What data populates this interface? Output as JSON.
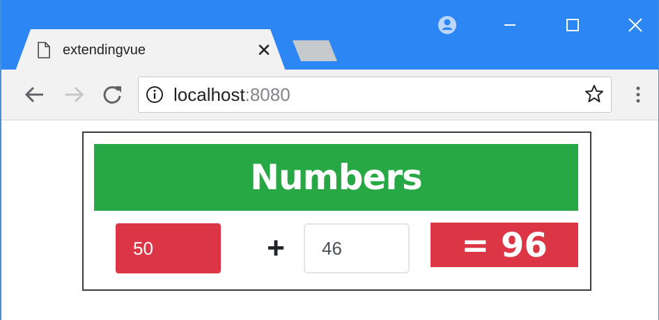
{
  "browser": {
    "tab_title": "extendingvue",
    "tab_close_glyph": "✕",
    "url_host": "localhost",
    "url_port": ":8080",
    "titlebar_color": "#2c86f3",
    "icons": {
      "tab": "page-icon",
      "profile": "account-icon",
      "minimize": "minimize-icon",
      "maximize": "maximize-icon",
      "close": "close-icon",
      "back": "back-arrow-icon",
      "forward": "forward-arrow-icon",
      "reload": "reload-icon",
      "info": "info-icon",
      "bookmark": "star-icon",
      "menu": "kebab-menu-icon"
    }
  },
  "app": {
    "header": "Numbers",
    "first_value": "50",
    "operator": "+",
    "second_value": "46",
    "result": "= 96",
    "colors": {
      "header_bg": "#28a745",
      "danger_bg": "#dc3545"
    }
  }
}
